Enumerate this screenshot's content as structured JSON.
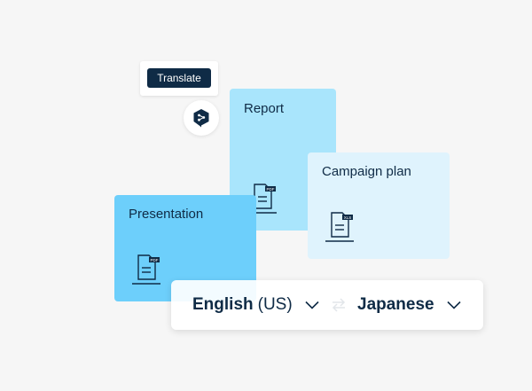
{
  "tooltip": {
    "button_label": "Translate"
  },
  "logo": {
    "icon": "deepl-logo-icon"
  },
  "cards": {
    "presentation": {
      "title": "Presentation",
      "icon": "pdf-document-icon",
      "color": "#6dcffb"
    },
    "report": {
      "title": "Report",
      "icon": "pdf-document-icon",
      "color": "#a9e5fc"
    },
    "campaign": {
      "title": "Campaign plan",
      "icon": "xlsx-document-icon",
      "color": "#dff3fd"
    }
  },
  "language_bar": {
    "source_language": "English",
    "source_variant": "(US)",
    "target_language": "Japanese",
    "swap_icon": "swap-arrows-icon",
    "chevron_icon": "chevron-down-icon"
  },
  "colors": {
    "navy": "#0f2b46",
    "background": "#f6f6f6"
  }
}
